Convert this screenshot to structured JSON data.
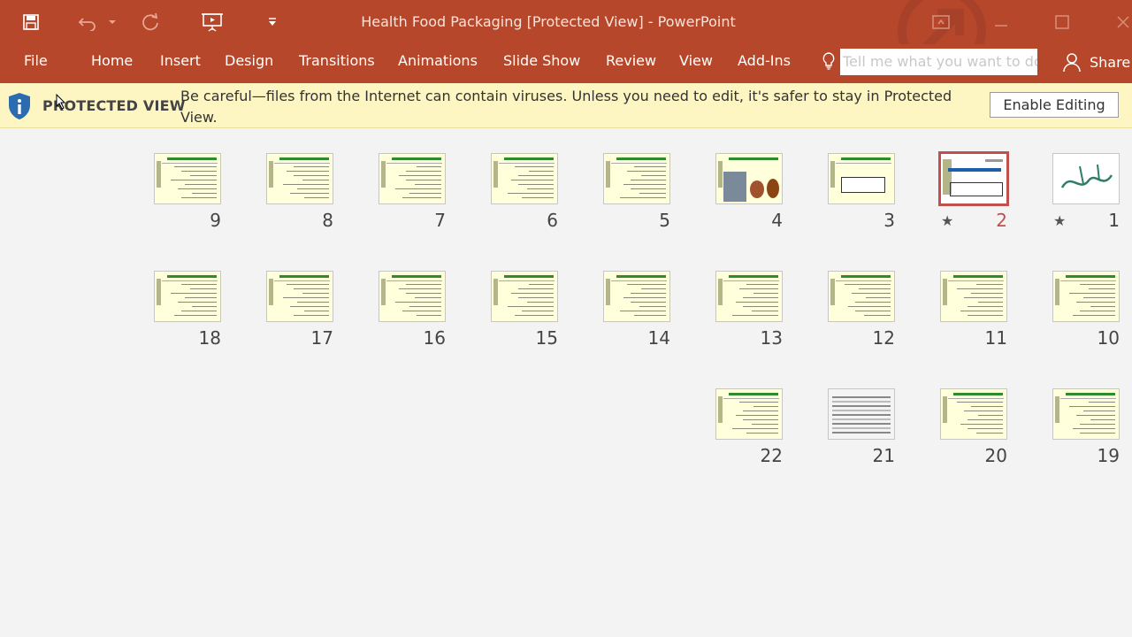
{
  "window": {
    "title": "Health Food Packaging [Protected View] - PowerPoint",
    "accent": "#b7472a"
  },
  "qat": {
    "icons": [
      "save-icon",
      "undo-icon",
      "redo-icon",
      "present-from-start-icon",
      "customize-qat-icon"
    ]
  },
  "ribbon": {
    "tabs": [
      "File",
      "Home",
      "Insert",
      "Design",
      "Transitions",
      "Animations",
      "Slide Show",
      "Review",
      "View",
      "Add-Ins"
    ],
    "tell_me_placeholder": "Tell me what you want to do",
    "share_label": "Share"
  },
  "message_bar": {
    "label": "PROTECTED VIEW",
    "text": "Be careful—files from the Internet can contain viruses. Unless you need to edit, it's safer to stay in Protected View.",
    "button": "Enable Editing"
  },
  "slides": [
    {
      "number": "1",
      "star": true,
      "selected": false,
      "kind": "calligraphy"
    },
    {
      "number": "2",
      "star": true,
      "selected": true,
      "kind": "title"
    },
    {
      "number": "3",
      "star": false,
      "selected": false,
      "kind": "box"
    },
    {
      "number": "4",
      "star": false,
      "selected": false,
      "kind": "photos"
    },
    {
      "number": "5",
      "star": false,
      "selected": false,
      "kind": "text"
    },
    {
      "number": "6",
      "star": false,
      "selected": false,
      "kind": "text"
    },
    {
      "number": "7",
      "star": false,
      "selected": false,
      "kind": "text"
    },
    {
      "number": "8",
      "star": false,
      "selected": false,
      "kind": "text"
    },
    {
      "number": "9",
      "star": false,
      "selected": false,
      "kind": "text"
    },
    {
      "number": "10",
      "star": false,
      "selected": false,
      "kind": "text"
    },
    {
      "number": "11",
      "star": false,
      "selected": false,
      "kind": "text"
    },
    {
      "number": "12",
      "star": false,
      "selected": false,
      "kind": "text"
    },
    {
      "number": "13",
      "star": false,
      "selected": false,
      "kind": "text"
    },
    {
      "number": "14",
      "star": false,
      "selected": false,
      "kind": "text"
    },
    {
      "number": "15",
      "star": false,
      "selected": false,
      "kind": "text"
    },
    {
      "number": "16",
      "star": false,
      "selected": false,
      "kind": "text"
    },
    {
      "number": "17",
      "star": false,
      "selected": false,
      "kind": "text"
    },
    {
      "number": "18",
      "star": false,
      "selected": false,
      "kind": "text"
    },
    {
      "number": "19",
      "star": false,
      "selected": false,
      "kind": "text"
    },
    {
      "number": "20",
      "star": false,
      "selected": false,
      "kind": "text"
    },
    {
      "number": "21",
      "star": false,
      "selected": false,
      "kind": "table"
    },
    {
      "number": "22",
      "star": false,
      "selected": false,
      "kind": "text"
    }
  ]
}
